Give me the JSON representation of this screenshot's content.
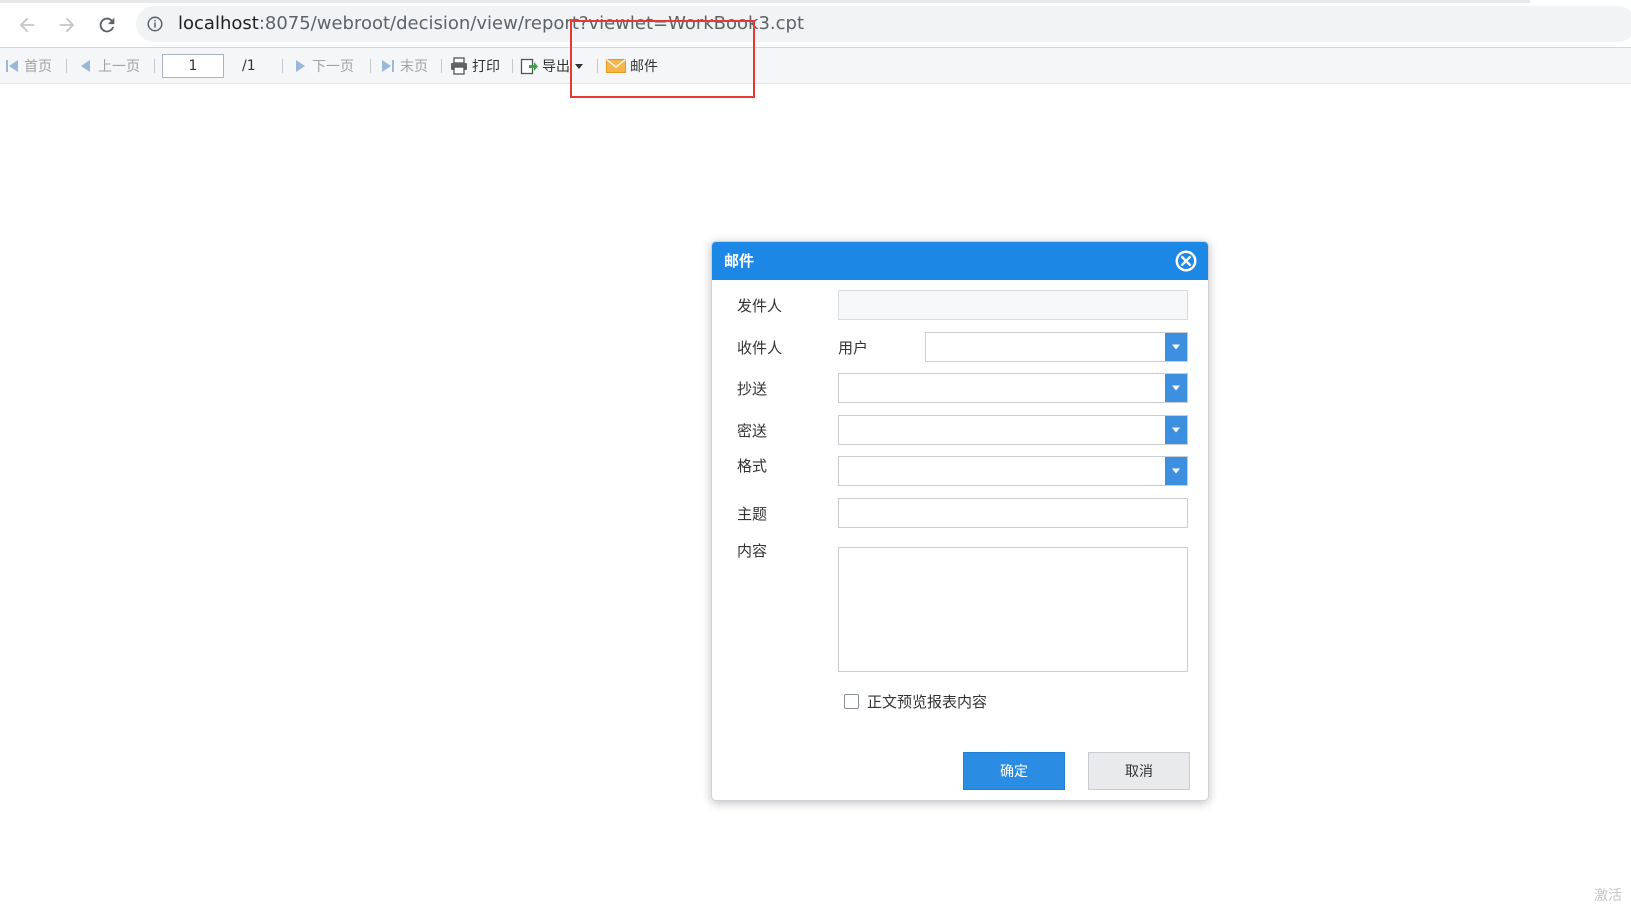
{
  "browser": {
    "url_host": "localhost",
    "url_rest": ":8075/webroot/decision/view/report?viewlet=WorkBook3.cpt"
  },
  "toolbar": {
    "first_page": "首页",
    "prev_page": "上一页",
    "page_number": "1",
    "page_total": "/1",
    "next_page": "下一页",
    "last_page": "末页",
    "print": "打印",
    "export": "导出",
    "email": "邮件"
  },
  "dialog": {
    "title": "邮件",
    "sender_label": "发件人",
    "sender_value": "",
    "recipient_label": "收件人",
    "recipient_type": "用户",
    "recipient_value": "",
    "cc_label": "抄送",
    "bcc_label": "密送",
    "format_label": "格式",
    "subject_label": "主题",
    "subject_value": "",
    "content_label": "内容",
    "content_value": "",
    "preview_checkbox_label": "正文预览报表内容",
    "preview_checked": false,
    "confirm_label": "确定",
    "cancel_label": "取消"
  },
  "corner_text": "激活",
  "colors": {
    "dialog_header": "#1c87e5",
    "confirm_button": "#2a8ce2",
    "highlight_box": "#e53935"
  }
}
